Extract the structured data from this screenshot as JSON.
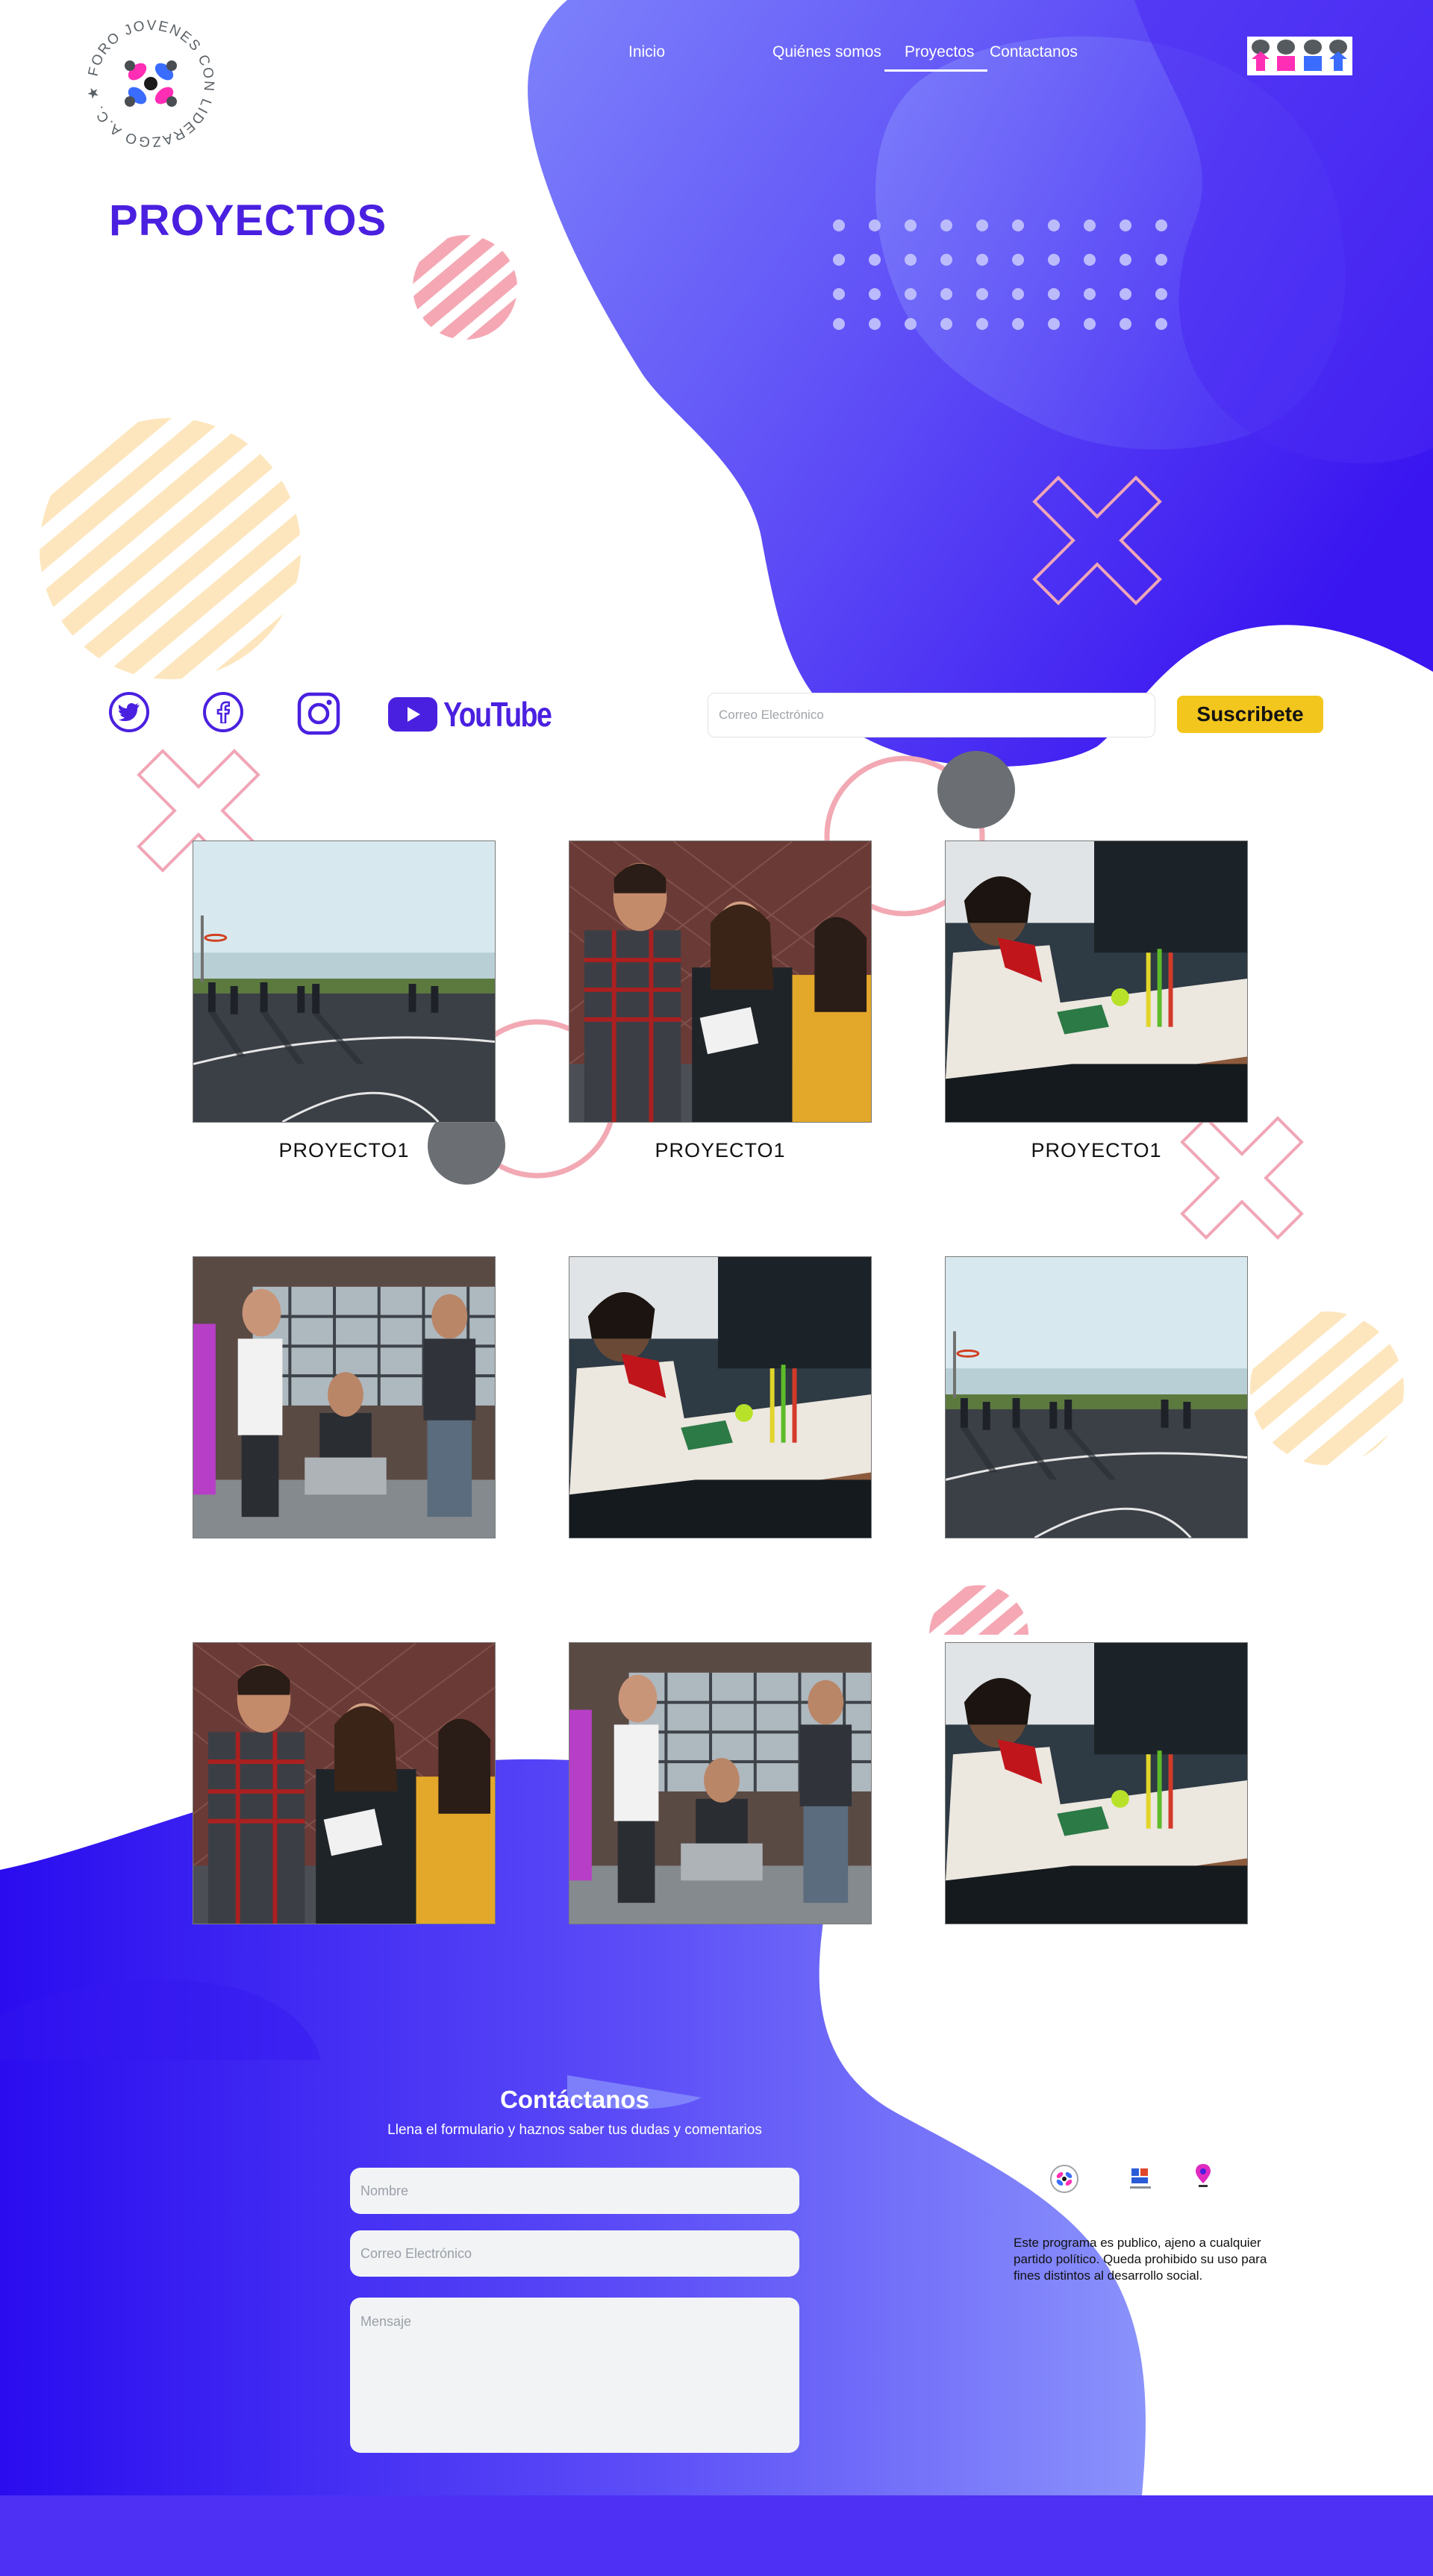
{
  "brand": {
    "logo_text": "FORO JOVENES CON LIDERAZGO A.C.",
    "partner_logo_alt": "partner-logo"
  },
  "nav": {
    "items": [
      {
        "label": "Inicio"
      },
      {
        "label": "Quiénes somos"
      },
      {
        "label": "Proyectos"
      },
      {
        "label": "Contactanos"
      }
    ],
    "active": "Proyectos"
  },
  "page": {
    "title": "PROYECTOS"
  },
  "social": {
    "twitter": "twitter-icon",
    "facebook": "facebook-icon",
    "instagram": "instagram-icon",
    "youtube_label": "YouTube"
  },
  "subscribe": {
    "placeholder": "Correo Electrónico",
    "button_label": "Suscribete"
  },
  "gallery": {
    "captions": [
      "PROYECTO1",
      "PROYECTO1",
      "PROYECTO1"
    ],
    "photos": [
      "basketball-court",
      "three-friends-talking",
      "students-at-table",
      "four-young-men",
      "students-at-table",
      "basketball-court",
      "three-friends-talking",
      "four-young-men",
      "students-at-table"
    ]
  },
  "contact": {
    "title": "Contáctanos",
    "subtitle": "Llena el formulario y haznos saber tus dudas y comentarios",
    "name_placeholder": "Nombre",
    "email_placeholder": "Correo Electrónico",
    "message_placeholder": "Mensaje"
  },
  "footer": {
    "disclaimer": "Este programa es publico, ajeno a cualquier partido  político. Queda prohibido su uso para fines distintos al desarrollo social."
  },
  "colors": {
    "primary": "#4a20e0",
    "accent_yellow": "#f3c61d",
    "blob_light": "#6f6cf9",
    "blob_dark": "#3a15f0",
    "pink": "#f5a8b4",
    "peach": "#fde6bd",
    "footer": "#4e30f5"
  }
}
